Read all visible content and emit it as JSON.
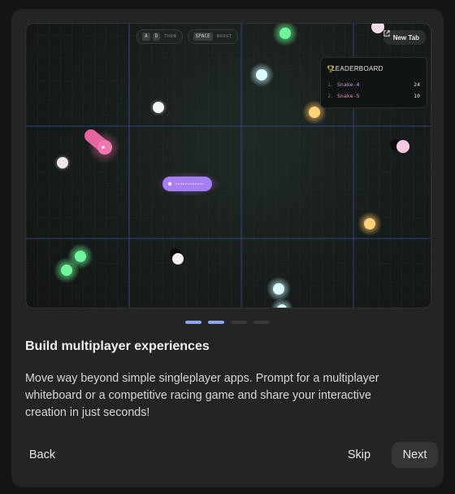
{
  "hud": {
    "turn_keys": [
      "A",
      "D"
    ],
    "turn_label": "TURN",
    "boost_key": "SPACE",
    "boost_label": "BOOST"
  },
  "new_tab": {
    "label": "New Tab",
    "icon": "external-link-icon"
  },
  "leaderboard": {
    "title": "LEADERBOARD",
    "icon": "trophy-icon",
    "rows": [
      {
        "rank": "1.",
        "name": "Snake-4",
        "score": "24",
        "color": "#b89af2"
      },
      {
        "rank": "2.",
        "name": "Snake-5",
        "score": "10",
        "color": "#ef8ac0"
      }
    ]
  },
  "pagination": {
    "total": 4,
    "active": [
      0,
      1
    ]
  },
  "content": {
    "title": "Build multiplayer experiences",
    "description": "Move way beyond simple singleplayer apps. Prompt for a multiplayer whiteboard or a competitive racing game and share your interactive creation in just seconds!"
  },
  "buttons": {
    "back": "Back",
    "skip": "Skip",
    "next": "Next"
  },
  "colors": {
    "accent": "#8aa6f0",
    "snake_purple": "#a77ef0",
    "snake_pink": "#e96aa8",
    "food_green": "#5ef08a",
    "food_cyan": "#cdf7ff",
    "food_orange": "#ffbf55"
  }
}
